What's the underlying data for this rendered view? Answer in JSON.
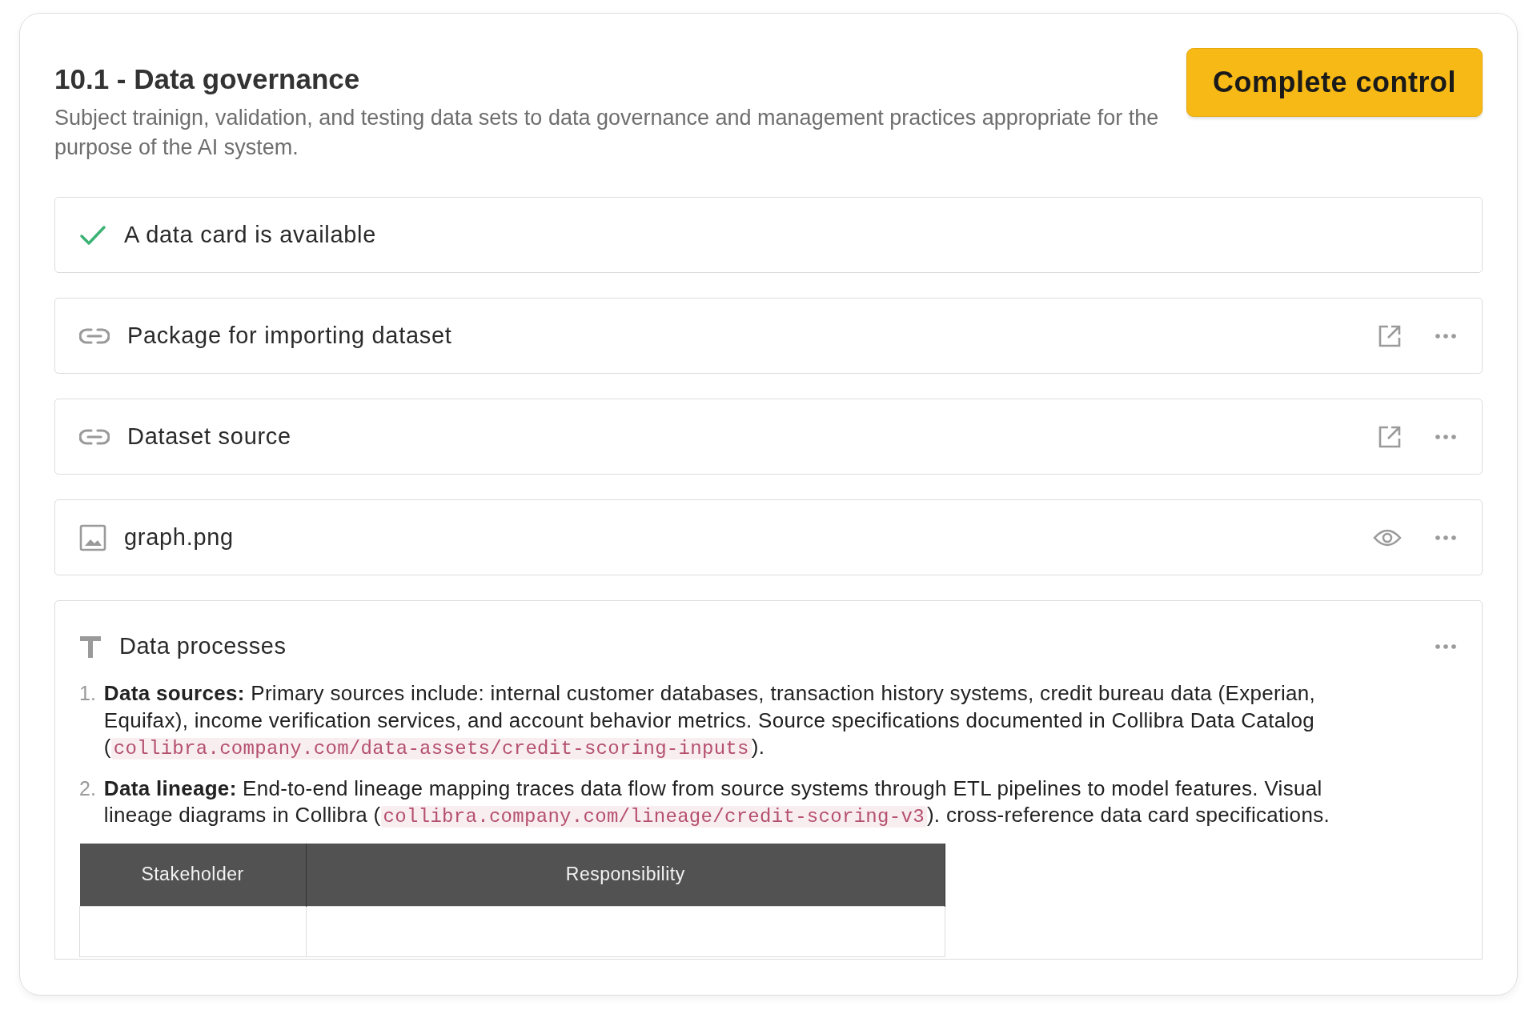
{
  "control": {
    "title": "10.1 - Data governance",
    "description": "Subject trainign, validation, and testing data sets to data governance and management practices appropriate for the purpose of the AI system.",
    "button": "Complete control"
  },
  "items": [
    {
      "kind": "check",
      "label": "A data card is available",
      "open_button": false,
      "preview_button": false,
      "menu_button": false
    },
    {
      "kind": "link",
      "label": "Package for importing dataset",
      "open_button": true,
      "preview_button": false,
      "menu_button": true
    },
    {
      "kind": "link",
      "label": "Dataset source",
      "open_button": true,
      "preview_button": false,
      "menu_button": true
    },
    {
      "kind": "image",
      "label": "graph.png",
      "open_button": false,
      "preview_button": true,
      "menu_button": true
    }
  ],
  "note": {
    "title": "Data processes",
    "menu_button": true,
    "list": [
      {
        "number": "1.",
        "parts": [
          {
            "kind": "text",
            "text": "**Data sources:** Primary sources include: internal customer databases, transaction history systems, credit bureau data (Experian, Equifax), income verification services, and account behavior metrics. Source specifications documented in Collibra Data Catalog ("
          },
          {
            "kind": "code",
            "text": "collibra.company.com/data-assets/credit-scoring-inputs"
          },
          {
            "kind": "text",
            "text": ")."
          }
        ]
      },
      {
        "number": "2.",
        "parts": [
          {
            "kind": "text",
            "text": "**Data lineage:** End-to-end lineage mapping traces data flow from source systems through ETL pipelines to model features. Visual lineage diagrams in Collibra ("
          },
          {
            "kind": "code",
            "text": "collibra.company.com/lineage/credit-scoring-v3"
          },
          {
            "kind": "text",
            "text": "). cross-reference data card specifications."
          }
        ]
      }
    ],
    "table": {
      "columns": [
        "Stakeholder",
        "Responsibility"
      ]
    }
  }
}
